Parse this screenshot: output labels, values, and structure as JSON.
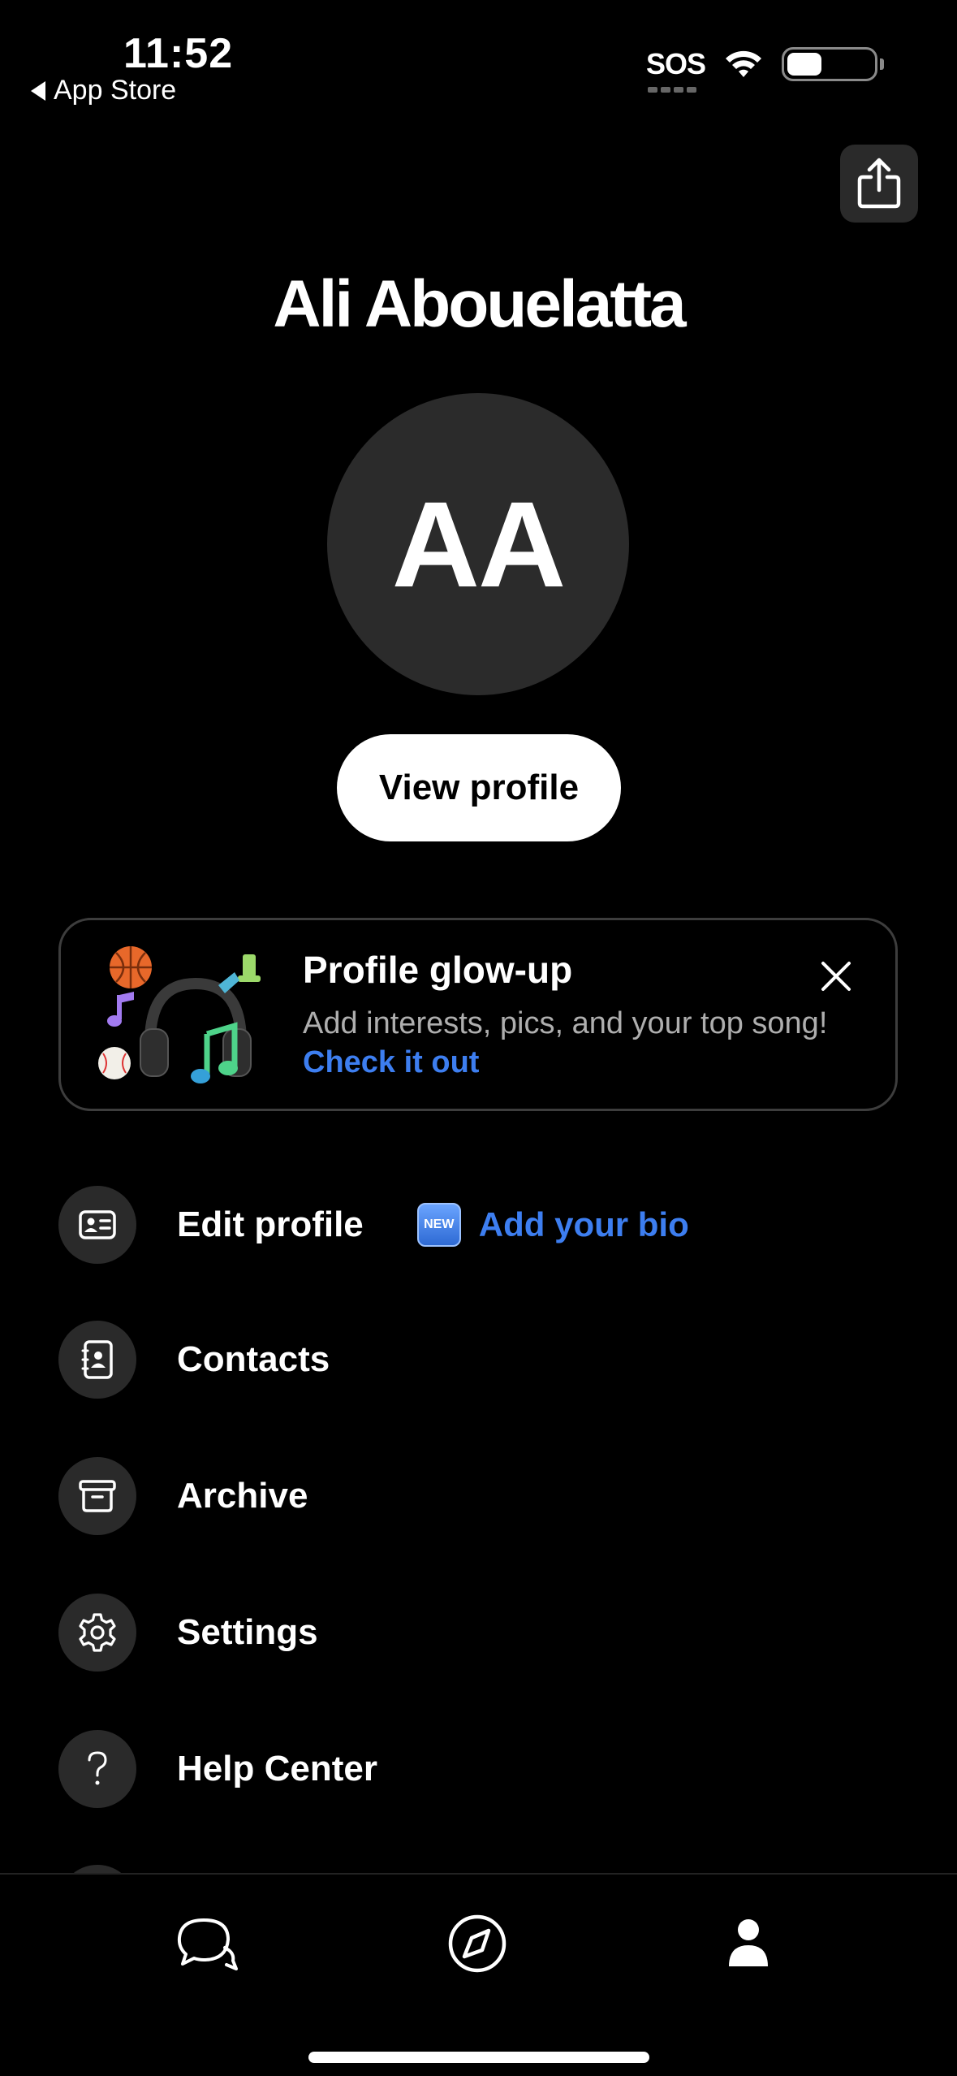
{
  "status_bar": {
    "time": "11:52",
    "back_app": "App Store",
    "sos": "SOS",
    "battery_level": 0.4
  },
  "profile": {
    "name": "Ali Abouelatta",
    "initials": "AA",
    "view_profile_label": "View profile"
  },
  "promo": {
    "title": "Profile glow-up",
    "description": "Add interests, pics, and your top song!",
    "link": "Check it out"
  },
  "menu": {
    "items": [
      {
        "label": "Edit profile",
        "icon": "id-card-icon",
        "badge": "NEW",
        "extra": "Add your bio"
      },
      {
        "label": "Contacts",
        "icon": "contacts-book-icon"
      },
      {
        "label": "Archive",
        "icon": "archive-box-icon"
      },
      {
        "label": "Settings",
        "icon": "gear-icon"
      },
      {
        "label": "Help Center",
        "icon": "question-mark-icon"
      }
    ]
  },
  "tabbar": {
    "tabs": [
      {
        "icon": "chats-icon",
        "active": false
      },
      {
        "icon": "compass-icon",
        "active": false
      },
      {
        "icon": "person-icon",
        "active": true
      }
    ]
  },
  "colors": {
    "background": "#000000",
    "accent_link": "#3d7ef0",
    "surface": "#2a2a2a"
  }
}
